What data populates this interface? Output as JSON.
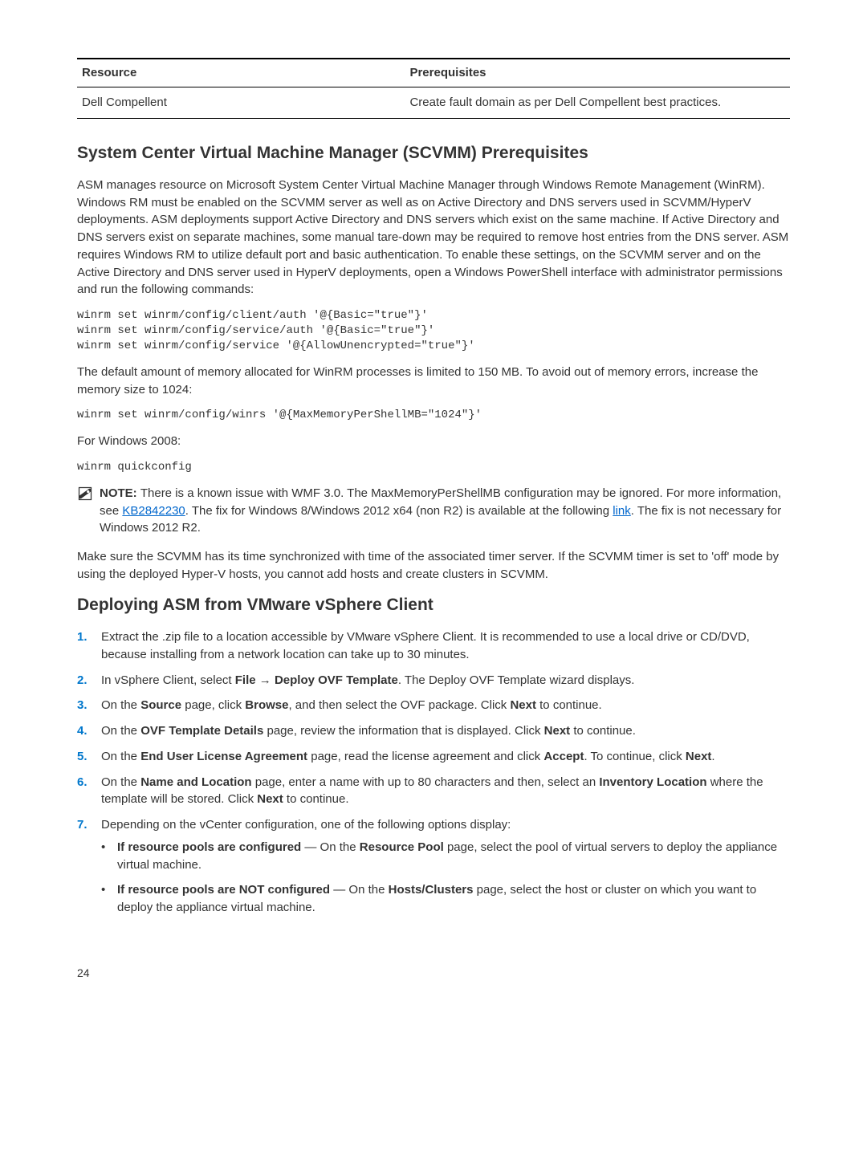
{
  "table": {
    "headers": {
      "c1": "Resource",
      "c2": "Prerequisites"
    },
    "row": {
      "c1": "Dell Compellent",
      "c2": "Create fault domain as per Dell Compellent best practices."
    }
  },
  "section1": {
    "heading": "System Center Virtual Machine Manager (SCVMM) Prerequisites",
    "p1": "ASM manages resource on Microsoft System Center Virtual Machine Manager through Windows Remote Management (WinRM). Windows RM must be enabled on the SCVMM server as well as on Active Directory and DNS servers used in SCVMM/HyperV deployments. ASM deployments support Active Directory and DNS servers which exist on the same machine. If Active Directory and DNS servers exist on separate machines, some manual tare-down may be required to remove host entries from the DNS server. ASM requires Windows RM to utilize default port and basic authentication. To enable these settings, on the SCVMM server and on the Active Directory and DNS server used in HyperV deployments, open a Windows PowerShell interface with administrator permissions and run the following commands:",
    "code1": "winrm set winrm/config/client/auth '@{Basic=\"true\"}'\nwinrm set winrm/config/service/auth '@{Basic=\"true\"}'\nwinrm set winrm/config/service '@{AllowUnencrypted=\"true\"}'",
    "p2": "The default amount of memory allocated for WinRM processes is limited to 150 MB. To avoid out of memory errors, increase the memory size to 1024:",
    "code2": "winrm set winrm/config/winrs '@{MaxMemoryPerShellMB=\"1024\"}'",
    "p3": "For Windows 2008:",
    "code3": "winrm quickconfig",
    "note_label": "NOTE: ",
    "note_a": "There is a known issue with WMF 3.0. The MaxMemoryPerShellMB configuration may be ignored. For more information, see ",
    "note_link1": "KB2842230",
    "note_b": ". The fix for Windows 8/Windows 2012 x64 (non R2) is available at the following ",
    "note_link2": "link",
    "note_c": ". The fix is not necessary for Windows 2012 R2.",
    "p4": "Make sure the SCVMM has its time synchronized with time of the associated timer server. If the SCVMM timer is set to 'off' mode by using the deployed Hyper-V hosts, you cannot add hosts and create clusters in SCVMM."
  },
  "section2": {
    "heading": "Deploying ASM from VMware vSphere Client",
    "steps": {
      "s1": "Extract the .zip file to a location accessible by VMware vSphere Client. It is recommended to use a local drive or CD/DVD, because installing from a network location can take up to 30 minutes.",
      "s2a": "In vSphere Client, select ",
      "s2b": "File → Deploy OVF Template",
      "s2c": ". The Deploy OVF Template wizard displays.",
      "s3a": "On the ",
      "s3b": "Source",
      "s3c": " page, click ",
      "s3d": "Browse",
      "s3e": ", and then select the OVF package. Click ",
      "s3f": "Next",
      "s3g": " to continue.",
      "s4a": "On the ",
      "s4b": "OVF Template Details",
      "s4c": " page, review the information that is displayed. Click ",
      "s4d": "Next",
      "s4e": " to continue.",
      "s5a": "On the ",
      "s5b": "End User License Agreement",
      "s5c": " page, read the license agreement and click ",
      "s5d": "Accept",
      "s5e": ". To continue, click ",
      "s5f": "Next",
      "s5g": ".",
      "s6a": "On the ",
      "s6b": "Name and Location",
      "s6c": " page, enter a name with up to 80 characters and then, select an ",
      "s6d": "Inventory Location",
      "s6e": " where the template will be stored. Click ",
      "s6f": "Next",
      "s6g": " to continue.",
      "s7": "Depending on the vCenter configuration, one of the following options display:",
      "b1a": "If resource pools are configured",
      "b1b": " — On the ",
      "b1c": "Resource Pool",
      "b1d": " page, select the pool of virtual servers to deploy the appliance virtual machine.",
      "b2a": "If resource pools are NOT configured",
      "b2b": " — On the ",
      "b2c": "Hosts/Clusters",
      "b2d": " page, select the host or cluster on which you want to deploy the appliance virtual machine."
    }
  },
  "pagenum": "24"
}
